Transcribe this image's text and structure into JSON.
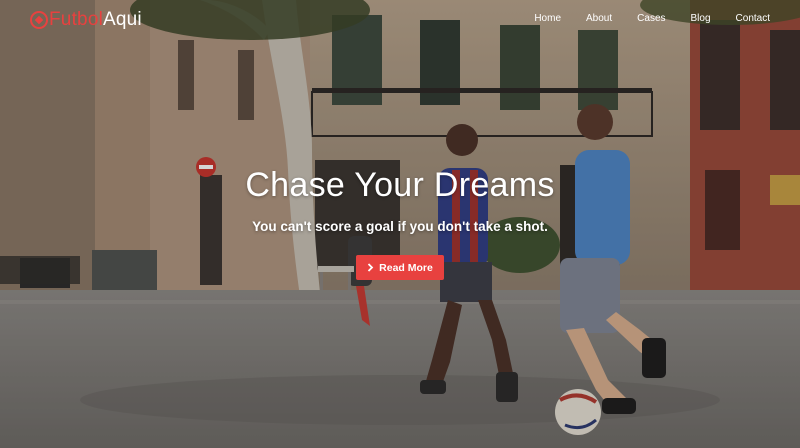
{
  "brand": {
    "name_part1": "Futbol",
    "name_part2": "Aqui",
    "accent_color": "#e8413f",
    "logo_icon": "soccer-ball-icon"
  },
  "nav": {
    "items": [
      {
        "label": "Home"
      },
      {
        "label": "About"
      },
      {
        "label": "Cases"
      },
      {
        "label": "Blog"
      },
      {
        "label": "Contact"
      }
    ]
  },
  "hero": {
    "title": "Chase Your Dreams",
    "subtitle": "You can't score a goal if you don't take a shot.",
    "cta_label": "Read More",
    "cta_icon": "chevron-right-icon",
    "background_image": "Two boys playing soccer on a city plaza street"
  }
}
